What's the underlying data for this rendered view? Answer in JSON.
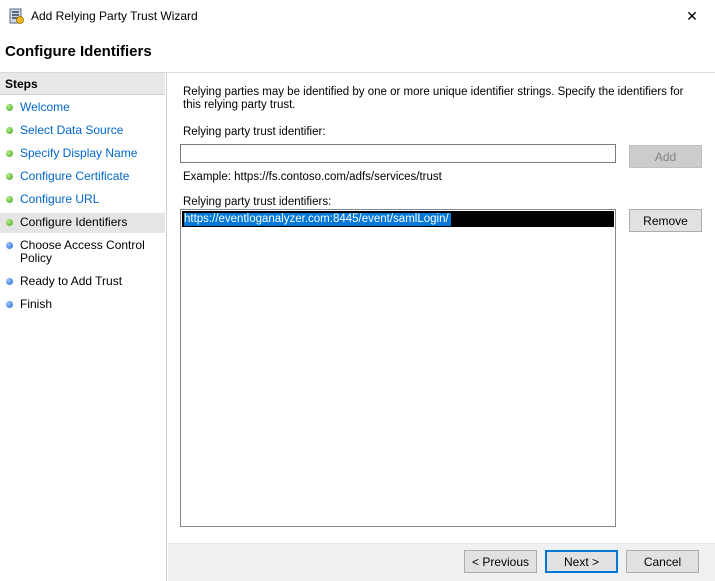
{
  "window": {
    "title": "Add Relying Party Trust Wizard",
    "close_glyph": "✕",
    "app_icon": "server-trust-icon"
  },
  "page": {
    "heading": "Configure Identifiers"
  },
  "steps": {
    "title": "Steps",
    "items": [
      {
        "label": "Welcome",
        "state": "done"
      },
      {
        "label": "Select Data Source",
        "state": "done"
      },
      {
        "label": "Specify Display Name",
        "state": "done"
      },
      {
        "label": "Configure Certificate",
        "state": "done"
      },
      {
        "label": "Configure URL",
        "state": "done"
      },
      {
        "label": "Configure Identifiers",
        "state": "current"
      },
      {
        "label": "Choose Access Control Policy",
        "state": "todo"
      },
      {
        "label": "Ready to Add Trust",
        "state": "todo"
      },
      {
        "label": "Finish",
        "state": "todo"
      }
    ]
  },
  "content": {
    "description": "Relying parties may be identified by one or more unique identifier strings. Specify the identifiers for this relying party trust.",
    "identifier_label": "Relying party trust identifier:",
    "identifier_value": "",
    "add_label": "Add",
    "example_text": "Example: https://fs.contoso.com/adfs/services/trust",
    "identifiers_label": "Relying party trust identifiers:",
    "identifiers": [
      "https://eventloganalyzer.com:8445/event/samlLogin/"
    ],
    "remove_label": "Remove"
  },
  "footer": {
    "previous_label": "< Previous",
    "next_label": "Next >",
    "cancel_label": "Cancel"
  },
  "colors": {
    "link": "#0066cc",
    "done_dot": "#3ea01a",
    "todo_dot": "#1e63d4",
    "selection": "#0078d7"
  }
}
